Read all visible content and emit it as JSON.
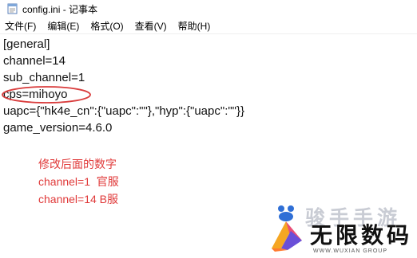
{
  "window": {
    "title": "config.ini - 记事本",
    "icon": "notepad-icon"
  },
  "menu": [
    {
      "label": "文件(F)"
    },
    {
      "label": "编辑(E)"
    },
    {
      "label": "格式(O)"
    },
    {
      "label": "查看(V)"
    },
    {
      "label": "帮助(H)"
    }
  ],
  "editor": {
    "lines": [
      "[general]",
      "channel=14",
      "sub_channel=1",
      "cps=mihoyo",
      "uapc={\"hk4e_cn\":{\"uapc\":\"\"},\"hyp\":{\"uapc\":\"\"}}",
      "game_version=4.6.0"
    ],
    "highlight_color": "#d93c3c"
  },
  "annotation": {
    "color": "#e03a3a",
    "lines": [
      "修改后面的数字",
      "channel=1  官服",
      "channel=14 B服"
    ]
  },
  "watermark": {
    "top_text": "骏手手游",
    "brand": "无限数码",
    "url": "WWW.WUXIAN GROUP"
  }
}
